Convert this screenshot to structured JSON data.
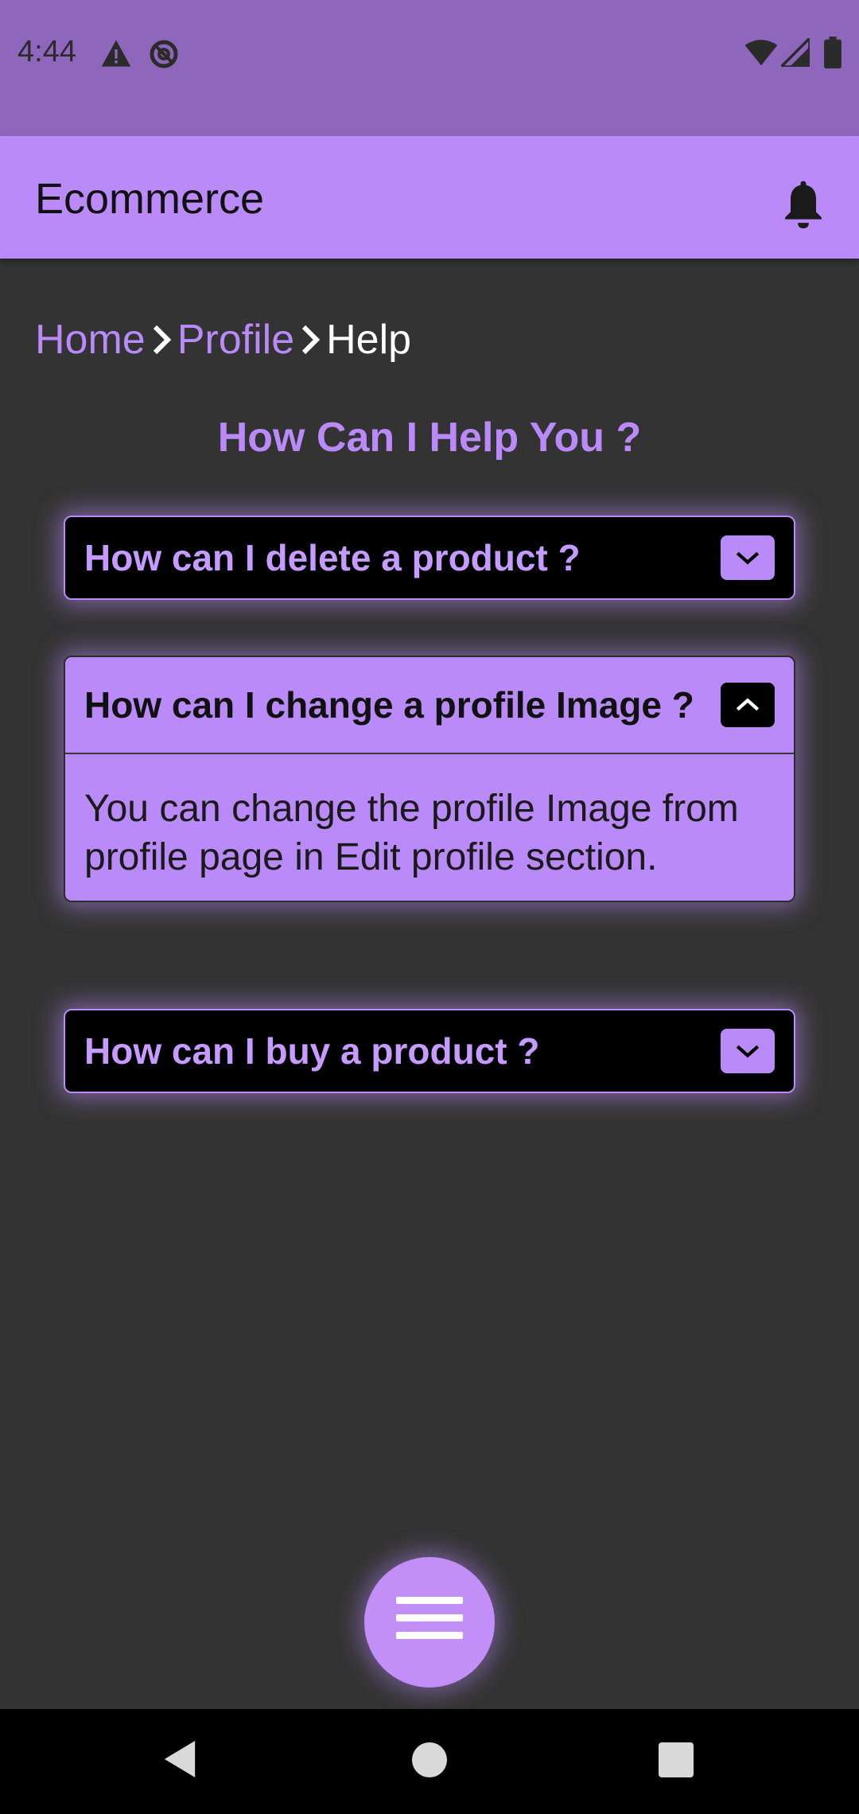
{
  "status_bar": {
    "time": "4:44"
  },
  "app_bar": {
    "title": "Ecommerce"
  },
  "breadcrumb": {
    "home": "Home",
    "profile": "Profile",
    "current": "Help"
  },
  "page": {
    "heading": "How Can I Help You ?"
  },
  "faqs": [
    {
      "question": "How can I delete a product ?",
      "expanded": false
    },
    {
      "question": "How can I change a profile Image ?",
      "answer": "You can change the profile Image from profile page in Edit profile section.",
      "expanded": true
    },
    {
      "question": "How can I buy a product ?",
      "expanded": false
    }
  ],
  "colors": {
    "accent": "#B98AF8",
    "status_bar": "#8E67BC",
    "background": "#333333"
  },
  "icons": [
    "warning-icon",
    "data-saver-icon",
    "wifi-icon",
    "signal-icon",
    "battery-icon",
    "bell-icon",
    "chevron-right-icon",
    "chevron-down-icon",
    "chevron-up-icon",
    "menu-icon",
    "back-icon",
    "home-icon",
    "recents-icon"
  ]
}
